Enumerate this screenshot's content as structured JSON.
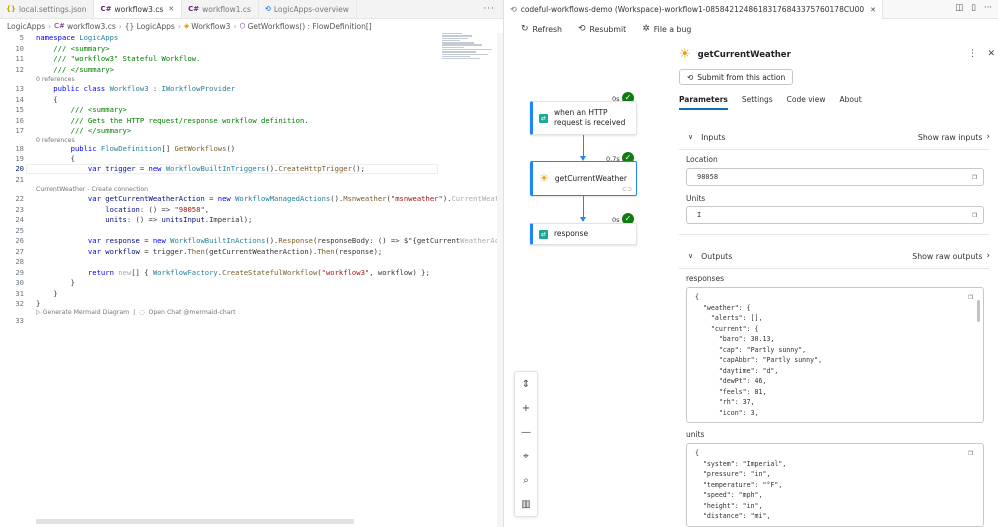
{
  "editor": {
    "tabs": [
      {
        "label": "local.settings.json",
        "icon": "{}"
      },
      {
        "label": "workflow3.cs",
        "icon": "C#"
      },
      {
        "label": "workflow1.cs",
        "icon": "C#"
      },
      {
        "label": "LogicApps-overview",
        "icon": "⟲"
      }
    ],
    "breadcrumb": [
      "LogicApps",
      "workflow3.cs",
      "{} LogicApps",
      "Workflow3",
      "GetWorkflows() : FlowDefinition[]"
    ],
    "lens": {
      "refs_a": "0 references",
      "refs_b": "0 references",
      "connection": "CurrentWeather - Create connection",
      "mermaid": "▷ Generate Mermaid Diagram  |  ◌  Open Chat @mermaid-chart"
    },
    "lines": {
      "n10": "10",
      "n11": "11",
      "n12": "12",
      "n13": "13",
      "n14": "14",
      "n15": "15",
      "n16": "16",
      "n17": "17",
      "n18": "18",
      "n19": "19",
      "n20": "20",
      "n21": "21",
      "n22": "22",
      "n23": "23",
      "n24": "24",
      "n25": "25",
      "n26": "26",
      "n27": "27",
      "n28": "28",
      "n29": "29",
      "n30": "30",
      "n31": "31",
      "n32": "32",
      "n33": "33",
      "n5": "5"
    },
    "code": {
      "l5_kw": "namespace",
      "l5_name": " LogicApps",
      "l10": "    /// <summary>",
      "l11": "    /// \"workflow3\" Stateful Workflow.",
      "l12": "    /// </summary>",
      "l13_kw": "    public class",
      "l13_cls": " Workflow3",
      "l13_p": " : ",
      "l13_if": "IWorkflowProvider",
      "l14": "    {",
      "l15": "        /// <summary>",
      "l16": "        /// Gets the HTTP request/response workflow definition.",
      "l17": "        /// </summary>",
      "l18_kw": "        public",
      "l18_t": " FlowDefinition",
      "l18_p": "[] ",
      "l18_f": "GetWorkflows",
      "l18_e": "()",
      "l19": "        {",
      "l20_kw": "            var",
      "l20_v": " trigger",
      "l20_p1": " = ",
      "l20_kw2": "new",
      "l20_t": " WorkflowBuiltInTriggers",
      "l20_p2": "().",
      "l20_f": "CreateHttpTrigger",
      "l20_e": "();",
      "l22_kw": "            var",
      "l22_v": " getCurrentWeatherAction",
      "l22_p1": " = ",
      "l22_kw2": "new",
      "l22_t": " WorkflowManagedActions",
      "l22_p2": "().",
      "l22_f": "Msnweather",
      "l22_p3": "(",
      "l22_s": "\"msnweather\"",
      "l22_p4": ").",
      "l22_g": "CurrentWeather(",
      "l23_v": "                location",
      "l23_p": ": () => ",
      "l23_s": "\"98058\"",
      "l23_e": ",",
      "l24_v": "                units",
      "l24_p": ": () => ",
      "l24_v2": "unitsInput",
      "l24_e": ".Imperial);",
      "l26_kw": "            var",
      "l26_v": " response",
      "l26_p1": " = ",
      "l26_kw2": "new",
      "l26_t": " WorkflowBuiltInActions",
      "l26_p2": "().",
      "l26_f": "Response",
      "l26_p3": "(responseBody: () => $\"{getCurrent",
      "l26_g": "WeatherAction",
      "l27_kw": "            var",
      "l27_v": " workflow",
      "l27_p1": " = trigger.",
      "l27_f": "Then",
      "l27_p2": "(getCurrentWeatherAction).",
      "l27_f2": "Then",
      "l27_e": "(response);",
      "l29_kw": "            return",
      "l29_g": " new",
      "l29_p1": "[] { ",
      "l29_t": "WorkflowFactory",
      "l29_p2": ".",
      "l29_f": "CreateStatefulWorkflow",
      "l29_p3": "(",
      "l29_s": "\"workflow3\"",
      "l29_e": ", workflow) };",
      "l30": "        }",
      "l31": "    }",
      "l32": "}"
    }
  },
  "designer": {
    "tab_title": "codeful-workflows-demo (Workspace)-workflow1-08584212486183176843375760178CU00",
    "toolbar": {
      "refresh": "Refresh",
      "resubmit": "Resubmit",
      "bug": "File a bug"
    },
    "nodes": [
      {
        "label": "when an HTTP request is received",
        "duration": "0s"
      },
      {
        "label": "getCurrentWeather",
        "duration": "0.7s"
      },
      {
        "label": "response",
        "duration": "0s"
      }
    ],
    "zoom_controls": [
      "fit-icon",
      "zoom-in-icon",
      "zoom-out-icon",
      "center-icon",
      "search-icon",
      "map-icon"
    ]
  },
  "details": {
    "title": "getCurrentWeather",
    "submit": "Submit from this action",
    "tabs": [
      "Parameters",
      "Settings",
      "Code view",
      "About"
    ],
    "inputs": {
      "header": "Inputs",
      "raw": "Show raw inputs",
      "location_label": "Location",
      "location_value": "98058",
      "units_label": "Units",
      "units_value": "I"
    },
    "outputs": {
      "header": "Outputs",
      "raw": "Show raw outputs",
      "responses_label": "responses",
      "responses_json": "{\n  \"weather\": {\n    \"alerts\": [],\n    \"current\": {\n      \"baro\": 30.13,\n      \"cap\": \"Partly sunny\",\n      \"capAbbr\": \"Partly sunny\",\n      \"daytime\": \"d\",\n      \"dewPt\": 46,\n      \"feels\": 81,\n      \"rh\": 37,\n      \"icon\": 3,",
      "units_label": "units",
      "units_json": "{\n  \"system\": \"Imperial\",\n  \"pressure\": \"in\",\n  \"temperature\": \"°F\",\n  \"speed\": \"mph\",\n  \"height\": \"in\",\n  \"distance\": \"mi\","
    }
  },
  "colors": {
    "accent": "#1f85ff",
    "success": "#107c10",
    "keyword": "#0000ff",
    "type": "#267f99",
    "string": "#a31515",
    "comment": "#008000"
  }
}
